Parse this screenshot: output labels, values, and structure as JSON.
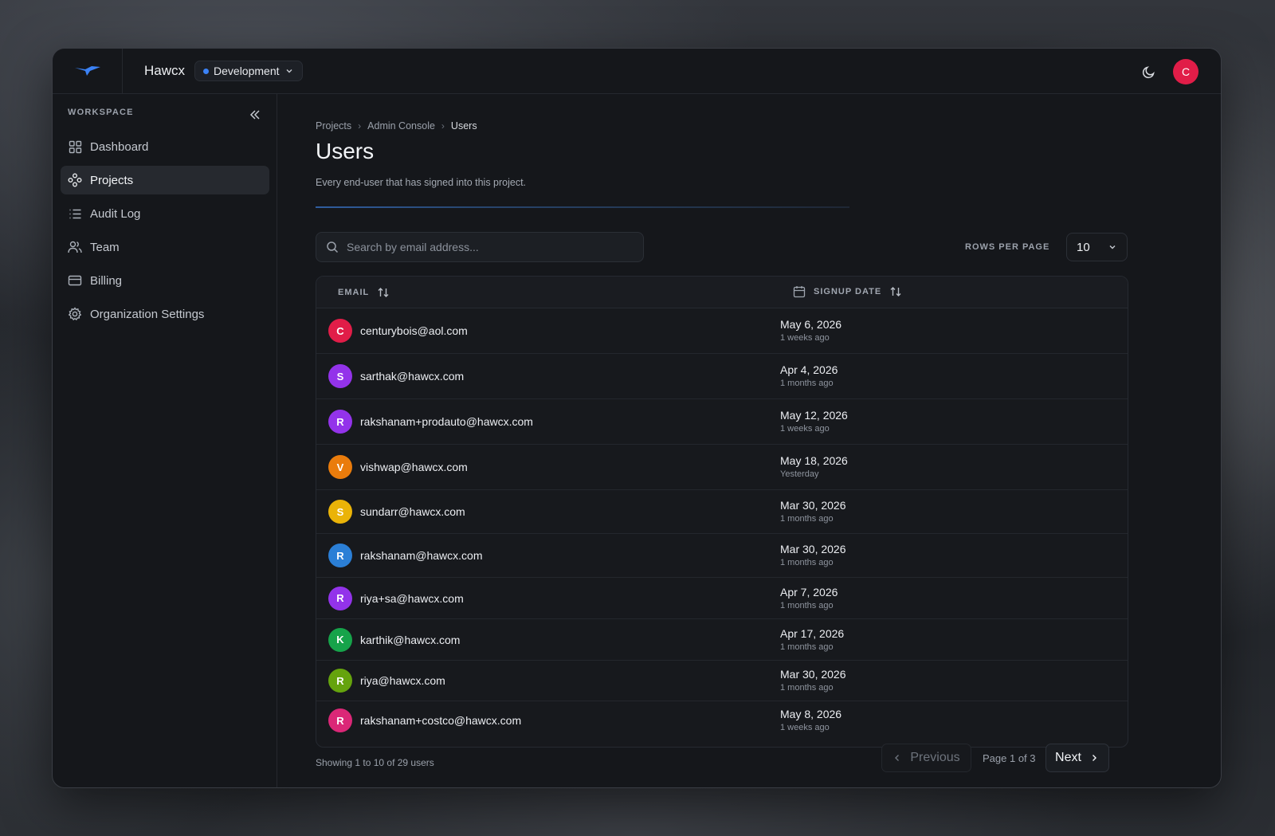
{
  "app": {
    "title": "Hawcx",
    "environment": "Development",
    "user_initial": "C",
    "accent": "#3b82f6",
    "brand_icon": "bird-logo-icon"
  },
  "sidebar": {
    "section_label": "WORKSPACE",
    "items": [
      {
        "label": "Dashboard",
        "icon": "grid-icon"
      },
      {
        "label": "Projects",
        "icon": "nodes-icon",
        "active": true
      },
      {
        "label": "Audit Log",
        "icon": "list-icon"
      },
      {
        "label": "Team",
        "icon": "users-icon"
      },
      {
        "label": "Billing",
        "icon": "credit-card-icon"
      },
      {
        "label": "Organization Settings",
        "icon": "gear-icon"
      }
    ]
  },
  "breadcrumb": [
    "Projects",
    "Admin Console",
    "Users"
  ],
  "page": {
    "title": "Users",
    "subtitle": "Every end-user that has signed into this project."
  },
  "search": {
    "placeholder": "Search by email address..."
  },
  "rows_per_page": {
    "label": "ROWS PER PAGE",
    "value": "10"
  },
  "table": {
    "columns": [
      "EMAIL",
      "SIGNUP DATE"
    ],
    "rows": [
      {
        "initial": "C",
        "color": "#e11d48",
        "email": "centurybois@aol.com",
        "date": "May 6, 2026",
        "relative": "1 weeks ago"
      },
      {
        "initial": "S",
        "color": "#9333ea",
        "email": "sarthak@hawcx.com",
        "date": "Apr 4, 2026",
        "relative": "1 months ago"
      },
      {
        "initial": "R",
        "color": "#9333ea",
        "email": "rakshanam+prodauto@hawcx.com",
        "date": "May 12, 2026",
        "relative": "1 weeks ago"
      },
      {
        "initial": "V",
        "color": "#ea7c0c",
        "email": "vishwap@hawcx.com",
        "date": "May 18, 2026",
        "relative": "Yesterday"
      },
      {
        "initial": "S",
        "color": "#eab308",
        "email": "sundarr@hawcx.com",
        "date": "Mar 30, 2026",
        "relative": "1 months ago"
      },
      {
        "initial": "R",
        "color": "#2b7fd6",
        "email": "rakshanam@hawcx.com",
        "date": "Mar 30, 2026",
        "relative": "1 months ago"
      },
      {
        "initial": "R",
        "color": "#9333ea",
        "email": "riya+sa@hawcx.com",
        "date": "Apr 7, 2026",
        "relative": "1 months ago"
      },
      {
        "initial": "K",
        "color": "#16a34a",
        "email": "karthik@hawcx.com",
        "date": "Apr 17, 2026",
        "relative": "1 months ago"
      },
      {
        "initial": "R",
        "color": "#65a30d",
        "email": "riya@hawcx.com",
        "date": "Mar 30, 2026",
        "relative": "1 months ago"
      },
      {
        "initial": "R",
        "color": "#db2777",
        "email": "rakshanam+costco@hawcx.com",
        "date": "May 8, 2026",
        "relative": "1 weeks ago"
      }
    ]
  },
  "footer": {
    "showing": "Showing 1 to 10 of 29 users",
    "previous": "Previous",
    "page_info": "Page 1 of 3",
    "next": "Next"
  }
}
